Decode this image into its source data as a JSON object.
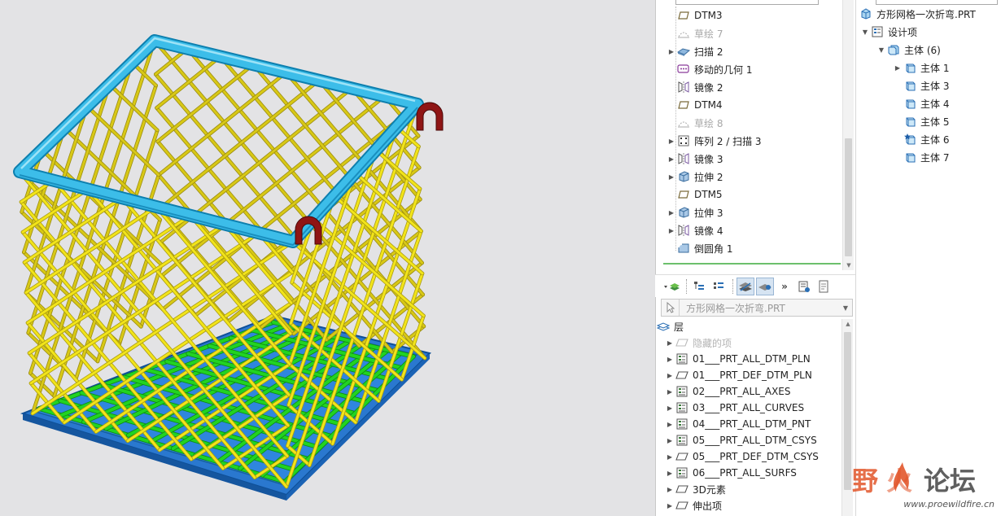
{
  "model_tree": {
    "items": [
      {
        "label": "DTM3",
        "icon": "datum-plane-icon",
        "expandable": false,
        "suppressed": false
      },
      {
        "label": "草绘 7",
        "icon": "sketch-icon",
        "expandable": false,
        "suppressed": true
      },
      {
        "label": "扫描 2",
        "icon": "sweep-icon",
        "expandable": true,
        "suppressed": false
      },
      {
        "label": "移动的几何 1",
        "icon": "moved-geometry-icon",
        "expandable": false,
        "suppressed": false
      },
      {
        "label": "镜像 2",
        "icon": "mirror-icon",
        "expandable": false,
        "suppressed": false
      },
      {
        "label": "DTM4",
        "icon": "datum-plane-icon",
        "expandable": false,
        "suppressed": false
      },
      {
        "label": "草绘 8",
        "icon": "sketch-icon",
        "expandable": false,
        "suppressed": true
      },
      {
        "label": "阵列 2 / 扫描 3",
        "icon": "pattern-icon",
        "expandable": true,
        "suppressed": false
      },
      {
        "label": "镜像 3",
        "icon": "mirror-icon",
        "expandable": true,
        "suppressed": false
      },
      {
        "label": "拉伸 2",
        "icon": "extrude-icon",
        "expandable": true,
        "suppressed": false
      },
      {
        "label": "DTM5",
        "icon": "datum-plane-icon",
        "expandable": false,
        "suppressed": false
      },
      {
        "label": "拉伸 3",
        "icon": "extrude-icon",
        "expandable": true,
        "suppressed": false
      },
      {
        "label": "镜像 4",
        "icon": "mirror-icon",
        "expandable": true,
        "suppressed": false
      },
      {
        "label": "倒圆角 1",
        "icon": "round-icon",
        "expandable": false,
        "suppressed": false
      }
    ]
  },
  "layer_panel": {
    "model_name": "方形网格一次折弯.PRT",
    "root_label": "层",
    "layers": [
      {
        "label": "隐藏的项",
        "icon": "hidden-items-icon",
        "faded": true
      },
      {
        "label": "01___PRT_ALL_DTM_PLN",
        "icon": "layer-icon",
        "faded": false
      },
      {
        "label": "01___PRT_DEF_DTM_PLN",
        "icon": "layer-plane-icon",
        "faded": false
      },
      {
        "label": "02___PRT_ALL_AXES",
        "icon": "layer-icon",
        "faded": false
      },
      {
        "label": "03___PRT_ALL_CURVES",
        "icon": "layer-icon",
        "faded": false
      },
      {
        "label": "04___PRT_ALL_DTM_PNT",
        "icon": "layer-icon",
        "faded": false
      },
      {
        "label": "05___PRT_ALL_DTM_CSYS",
        "icon": "layer-icon",
        "faded": false
      },
      {
        "label": "05___PRT_DEF_DTM_CSYS",
        "icon": "layer-plane-icon",
        "faded": false
      },
      {
        "label": "06___PRT_ALL_SURFS",
        "icon": "layer-icon",
        "faded": false
      },
      {
        "label": "3D元素",
        "icon": "layer-plane-icon",
        "faded": false
      },
      {
        "label": "伸出项",
        "icon": "layer-plane-icon",
        "faded": false
      }
    ]
  },
  "body_tree": {
    "root": "方形网格一次折弯.PRT",
    "design_items": "设计项",
    "bodies_group": "主体 (6)",
    "bodies": [
      {
        "label": "主体 1",
        "expandable": true,
        "default": false
      },
      {
        "label": "主体 3",
        "expandable": false,
        "default": false
      },
      {
        "label": "主体 4",
        "expandable": false,
        "default": false
      },
      {
        "label": "主体 5",
        "expandable": false,
        "default": false
      },
      {
        "label": "主体 6",
        "expandable": false,
        "default": true
      },
      {
        "label": "主体 7",
        "expandable": false,
        "default": false
      }
    ]
  },
  "watermark": {
    "logo": "野火论坛",
    "site": "www.proewildfire.cn"
  },
  "colors": {
    "viewport_bg": "#e3e3e5",
    "top_frame": "#37b7e6",
    "mesh": "#f2e41a",
    "bottom_grid": "#22d322",
    "base_tray": "#1f78d6",
    "hooks": "#8f1515",
    "selection_line": "#6cc06c"
  }
}
